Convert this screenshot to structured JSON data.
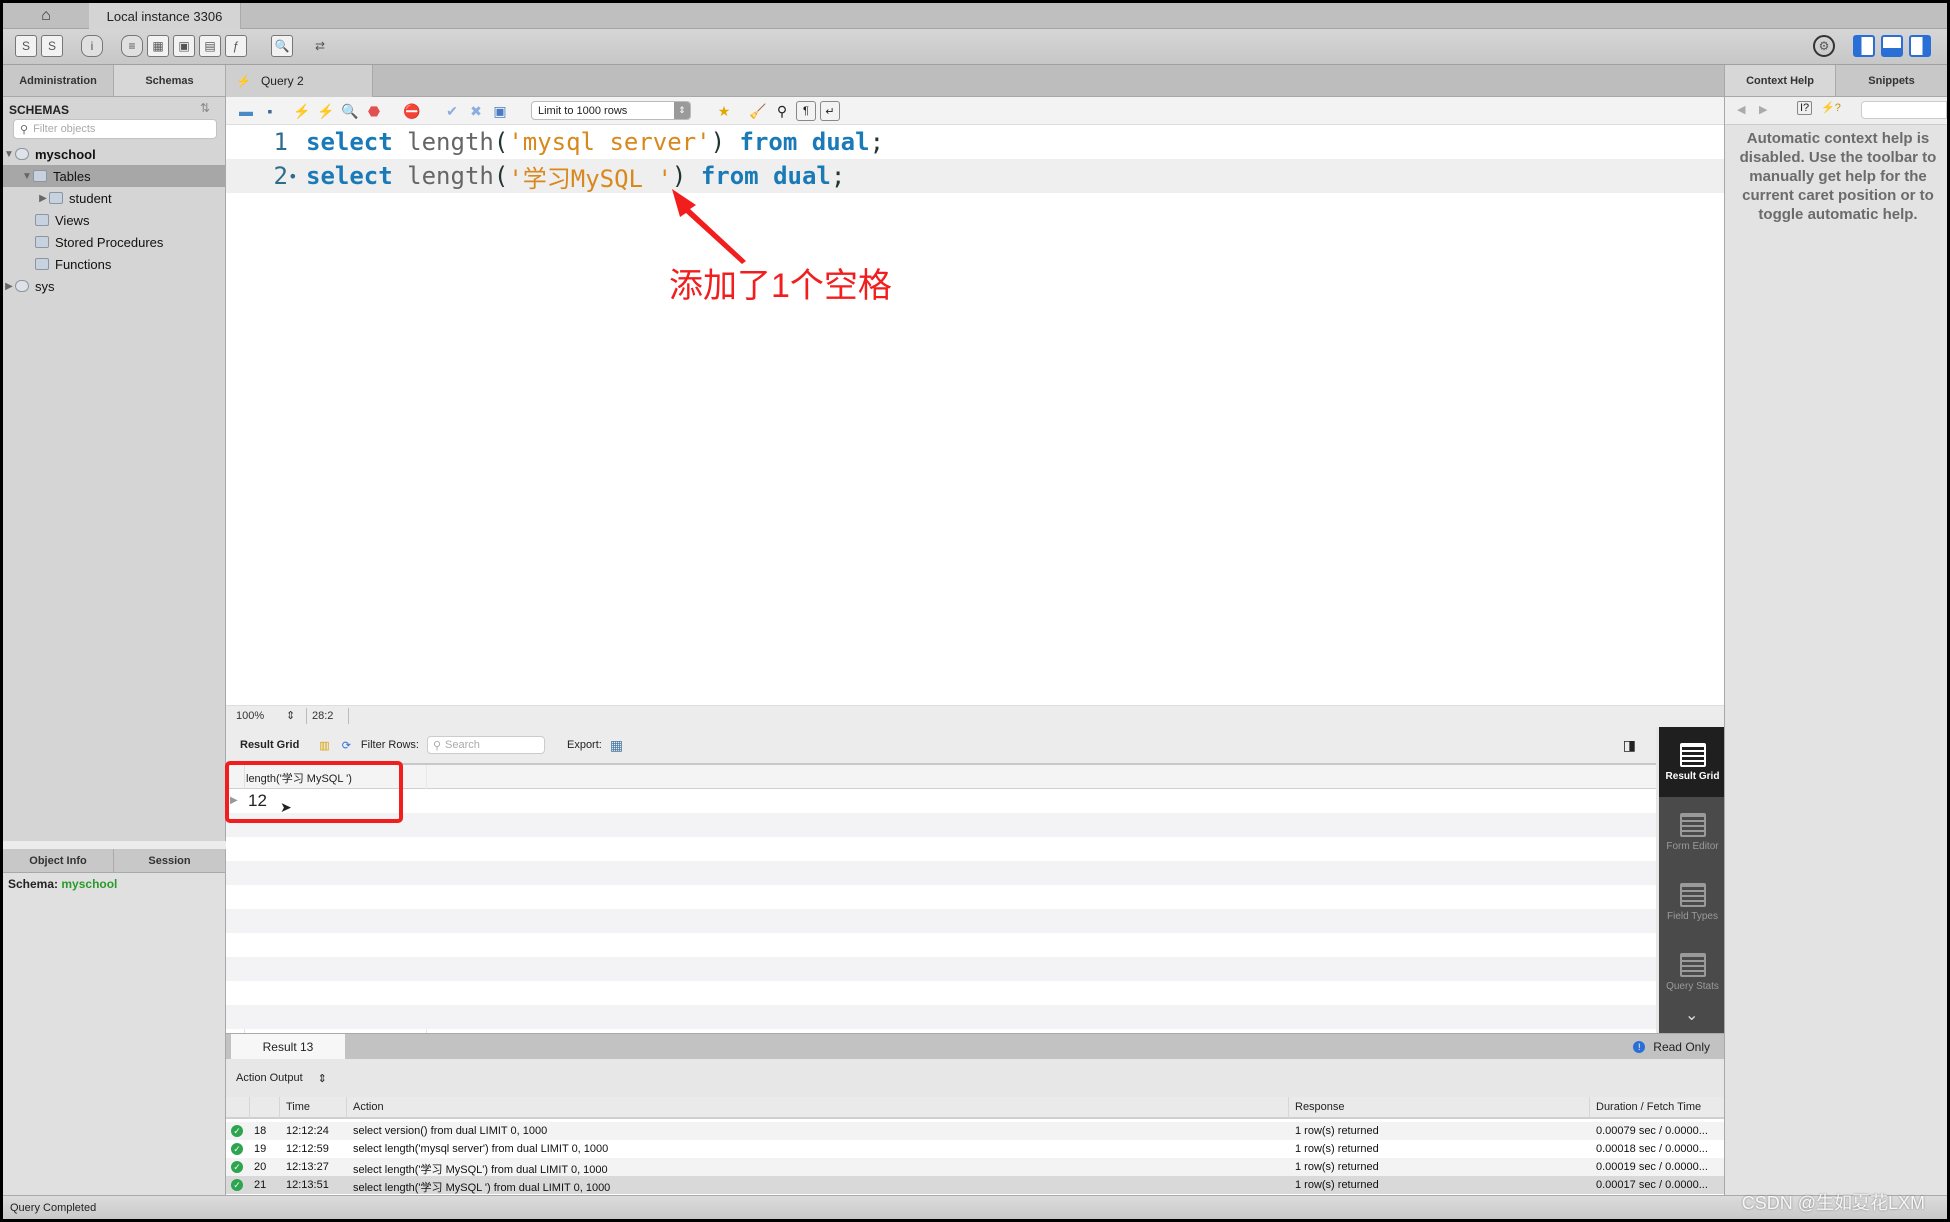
{
  "titlebar": {
    "home_icon": "home-icon",
    "instance_tab": "Local instance 3306"
  },
  "main_toolbar": {
    "icons": [
      "new-sql-tab-icon",
      "open-sql-file-icon",
      "schema-inspector-icon",
      "create-schema-icon",
      "create-table-icon",
      "create-view-icon",
      "create-procedure-icon",
      "create-function-icon",
      "search-table-data-icon",
      "reconnect-icon"
    ],
    "right_icons": [
      "settings-icon",
      "toggle-sidebar-icon",
      "toggle-output-icon",
      "toggle-secondary-sidebar-icon"
    ],
    "accent_color": "#2a6fd6"
  },
  "sidebar": {
    "tabs": [
      "Administration",
      "Schemas"
    ],
    "active_tab": "Schemas",
    "header": "SCHEMAS",
    "filter_placeholder": "Filter objects",
    "tree": [
      {
        "label": "myschool",
        "level": 0,
        "expanded": true,
        "type": "schema"
      },
      {
        "label": "Tables",
        "level": 1,
        "expanded": true,
        "type": "folder",
        "selected": true
      },
      {
        "label": "student",
        "level": 2,
        "expanded": false,
        "type": "table"
      },
      {
        "label": "Views",
        "level": 1,
        "type": "folder"
      },
      {
        "label": "Stored Procedures",
        "level": 1,
        "type": "folder"
      },
      {
        "label": "Functions",
        "level": 1,
        "type": "folder"
      },
      {
        "label": "sys",
        "level": 0,
        "expanded": false,
        "type": "schema"
      }
    ]
  },
  "info_panel": {
    "tabs": [
      "Object Info",
      "Session"
    ],
    "schema_label": "Schema:",
    "schema_value": "myschool",
    "schema_color": "#2a9a2a"
  },
  "editor": {
    "tab_label": "Query 2",
    "limit_select": "Limit to 1000 rows",
    "lines": [
      {
        "num": "1",
        "kw1": "select",
        "fn": "length",
        "open": "(",
        "str": "'mysql server'",
        "close": ")",
        "kw2": "from",
        "kw3": "dual",
        "end": ";"
      },
      {
        "num": "2",
        "marker": "•",
        "kw1": "select",
        "fn": "length",
        "open": "(",
        "str": "'学习MySQL '",
        "close": ")",
        "kw2": "from",
        "kw3": "dual",
        "end": ";"
      }
    ],
    "annotation": "添加了1个空格",
    "annotation_color": "#f21d1d",
    "zoom": "100%",
    "cursor_pos": "28:2"
  },
  "result": {
    "label": "Result Grid",
    "filter_label": "Filter Rows:",
    "search_placeholder": "Search",
    "export_label": "Export:",
    "column": "length('学习 MySQL ')",
    "value": "12",
    "side_buttons": [
      {
        "label": "Result Grid",
        "active": true
      },
      {
        "label": "Form Editor"
      },
      {
        "label": "Field Types"
      },
      {
        "label": "Query Stats"
      }
    ],
    "tab": "Result 13",
    "read_only": "Read Only"
  },
  "output": {
    "selector": "Action Output",
    "columns": [
      "",
      "",
      "Time",
      "Action",
      "Response",
      "Duration / Fetch Time"
    ],
    "rows": [
      {
        "num": "18",
        "time": "12:12:24",
        "action": "select version() from dual LIMIT 0, 1000",
        "response": "1 row(s) returned",
        "duration": "0.00079 sec / 0.0000..."
      },
      {
        "num": "19",
        "time": "12:12:59",
        "action": "select length('mysql server') from dual LIMIT 0, 1000",
        "response": "1 row(s) returned",
        "duration": "0.00018 sec / 0.0000..."
      },
      {
        "num": "20",
        "time": "12:13:27",
        "action": "select length('学习 MySQL') from dual LIMIT 0, 1000",
        "response": "1 row(s) returned",
        "duration": "0.00019 sec / 0.0000..."
      },
      {
        "num": "21",
        "time": "12:13:51",
        "action": "select length('学习 MySQL ') from dual LIMIT 0, 1000",
        "response": "1 row(s) returned",
        "duration": "0.00017 sec / 0.0000..."
      }
    ]
  },
  "right_panel": {
    "tabs": [
      "Context Help",
      "Snippets"
    ],
    "help_text": "Automatic context help is disabled. Use the toolbar to manually get help for the current caret position or to toggle automatic help."
  },
  "status": {
    "text": "Query Completed"
  },
  "watermark": "CSDN @生如夏花LXM"
}
